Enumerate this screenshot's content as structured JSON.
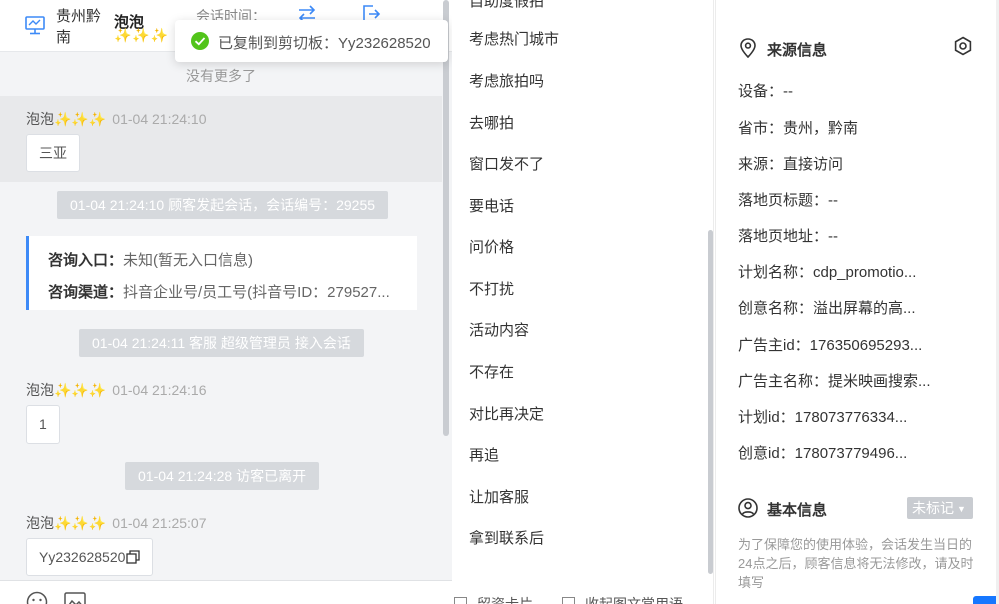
{
  "chat_header": {
    "location": "贵州黔南",
    "customer_name": "泡泡",
    "customer_sparkles": "✨✨✨",
    "session_time_label": "会话时间："
  },
  "toast": {
    "text": "已复制到剪切板：Yy232628520"
  },
  "chat": {
    "no_more": "没有更多了",
    "sender_name": "泡泡✨✨✨",
    "msg1": {
      "time": "01-04 21:24:10",
      "text": "三亚"
    },
    "sys1": "01-04 21:24:10 顾客发起会话，会话编号：29255",
    "inquiry_entry_label": "咨询入口：",
    "inquiry_entry_value": "未知(暂无入口信息)",
    "inquiry_channel_label": "咨询渠道：",
    "inquiry_channel_value": "抖音企业号/员工号(抖音号ID：279527...",
    "sys2": "01-04 21:24:11 客服 超级管理员 接入会话",
    "msg2": {
      "time": "01-04 21:24:16",
      "text": "1"
    },
    "sys3": "01-04 21:24:28 访客已离开",
    "msg3": {
      "time": "01-04 21:25:07",
      "text": "Yy232628520"
    }
  },
  "quick_replies": {
    "cut_top": "自助度假拍",
    "items": [
      "考虑热门城市",
      "考虑旅拍吗",
      "去哪拍",
      "窗口发不了",
      "要电话",
      "问价格",
      "不打扰",
      "活动内容",
      "不存在",
      "对比再决定",
      "再追",
      "让加客服",
      "拿到联系后"
    ],
    "bottom_left": "留资卡片",
    "bottom_right": "收起图文常用语"
  },
  "source_info": {
    "title": "来源信息",
    "fields": [
      "设备：--",
      "省市：贵州，黔南",
      "来源：直接访问",
      "落地页标题：--",
      "落地页地址：--",
      "计划名称：cdp_promotio...",
      "创意名称：溢出屏幕的高...",
      "广告主id：176350695293...",
      "广告主名称：提米映画搜索...",
      "计划id：178073776334...",
      "创意id：178073779496..."
    ]
  },
  "basic_info": {
    "title": "基本信息",
    "tag_select": "未标记",
    "notice": "为了保障您的使用体验，会话发生当日的24点之后，顾客信息将无法修改，请及时填写"
  },
  "colors": {
    "accent": "#3d8af7",
    "success": "#52c41a",
    "system_bg": "#d6d9dd"
  }
}
